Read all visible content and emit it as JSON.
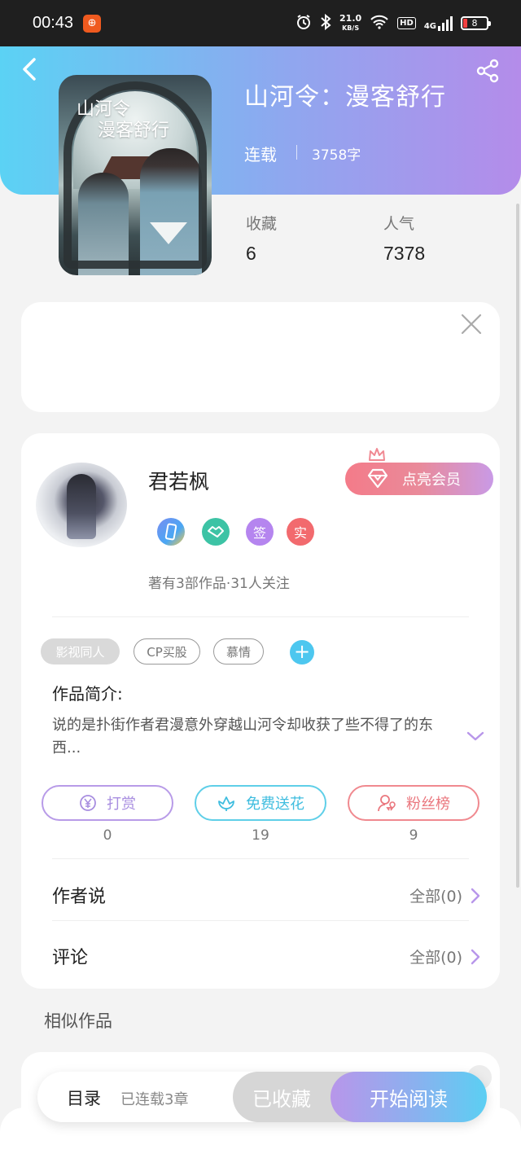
{
  "status_bar": {
    "time": "00:43",
    "app_badge": "⊕",
    "net_speed_value": "21.0",
    "net_speed_unit": "KB/S",
    "hd_label": "HD",
    "network_label": "4G",
    "battery_level": "8"
  },
  "book": {
    "title": "山河令：漫客舒行",
    "status": "连载",
    "word_count": "3758字",
    "cover_text_line1": "山河令",
    "cover_text_line2": "漫客舒行",
    "stats": [
      {
        "label": "收藏",
        "value": "6"
      },
      {
        "label": "人气",
        "value": "7378"
      }
    ]
  },
  "author": {
    "name": "君若枫",
    "vip_button_label": "点亮会员",
    "badges": [
      {
        "icon": "phone-icon",
        "text": ""
      },
      {
        "icon": "handshake-icon",
        "text": ""
      },
      {
        "icon": "sign-icon",
        "text": "签"
      },
      {
        "icon": "real-icon",
        "text": "实"
      }
    ],
    "meta": "著有3部作品·31人关注"
  },
  "tags": {
    "items": [
      "影视同人",
      "CP买股",
      "慕情"
    ],
    "add_label": "+"
  },
  "intro": {
    "label": "作品简介:",
    "text": "说的是扑街作者君漫意外穿越山河令却收获了些不得了的东西..."
  },
  "actions": [
    {
      "label": "打赏",
      "icon": "yen-icon",
      "count": "0"
    },
    {
      "label": "免费送花",
      "icon": "flower-icon",
      "count": "19"
    },
    {
      "label": "粉丝榜",
      "icon": "fans-icon",
      "count": "9"
    }
  ],
  "rows": [
    {
      "label": "作者说",
      "right": "全部(0)"
    },
    {
      "label": "评论",
      "right": "全部(0)"
    }
  ],
  "similar": {
    "title": "相似作品"
  },
  "bottom_bar": {
    "toc_label": "目录",
    "chapters_label": "已连载3章",
    "collect_label": "已收藏",
    "read_label": "开始阅读"
  },
  "colors": {
    "header_start": "#5bd2f4",
    "header_end": "#b48cea",
    "vip_start": "#f47b89",
    "vip_end": "#c99ae6",
    "accent_blue": "#4dc7ef"
  }
}
